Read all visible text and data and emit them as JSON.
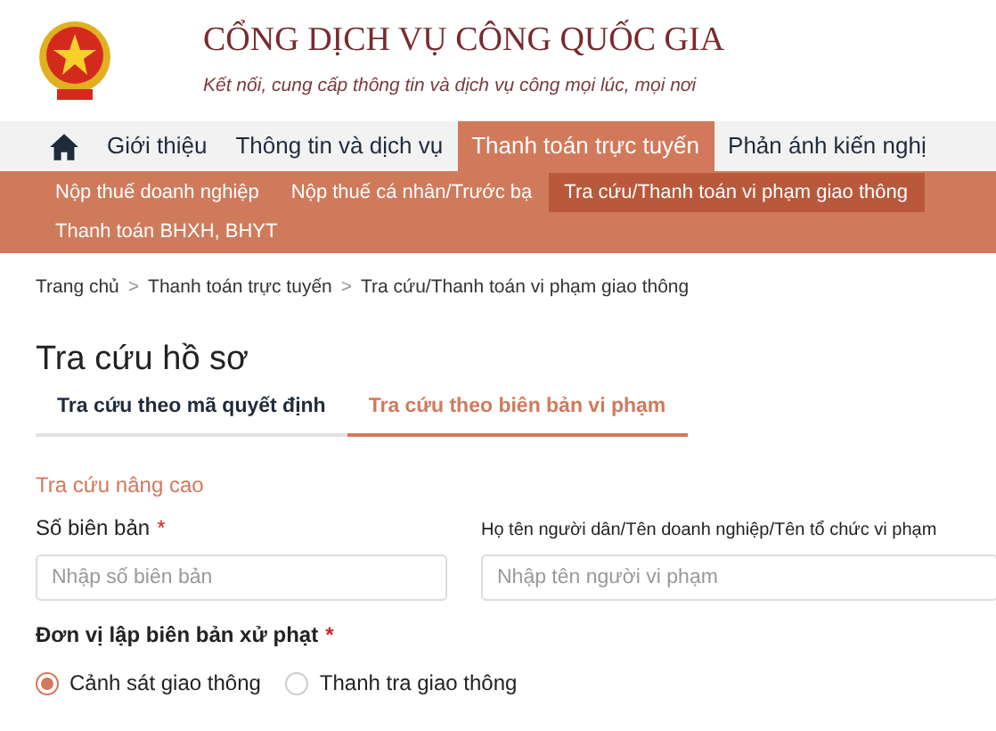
{
  "header": {
    "title": "CỔNG DỊCH VỤ CÔNG QUỐC GIA",
    "tagline": "Kết nối, cung cấp thông tin và dịch vụ công mọi lúc, mọi nơi"
  },
  "nav": {
    "items": [
      {
        "label": "Giới thiệu",
        "selected": false
      },
      {
        "label": "Thông tin và dịch vụ",
        "selected": false
      },
      {
        "label": "Thanh toán trực tuyến",
        "selected": true
      },
      {
        "label": "Phản ánh kiến nghị",
        "selected": false
      }
    ]
  },
  "submenu": {
    "items": [
      {
        "label": "Nộp thuế doanh nghiệp",
        "selected": false
      },
      {
        "label": "Nộp thuế cá nhân/Trước bạ",
        "selected": false
      },
      {
        "label": "Tra cứu/Thanh toán vi phạm giao thông",
        "selected": true
      },
      {
        "label": "Thanh toán BHXH, BHYT",
        "selected": false
      }
    ]
  },
  "breadcrumb": [
    "Trang chủ",
    "Thanh toán trực tuyến",
    "Tra cứu/Thanh toán vi phạm giao thông"
  ],
  "breadcrumb_separator": ">",
  "page_title": "Tra cứu hồ sơ",
  "tabs": [
    {
      "label": "Tra cứu theo mã quyết định",
      "selected": false
    },
    {
      "label": "Tra cứu theo biên bản vi phạm",
      "selected": true
    }
  ],
  "section_title": "Tra cứu nâng cao",
  "fields": [
    {
      "label": "Số biên bản",
      "required_mark": "*",
      "placeholder": "Nhập số biên bản"
    },
    {
      "label": "Họ tên người dân/Tên doanh nghiệp/Tên tổ chức vi phạm",
      "placeholder": "Nhập tên người vi phạm"
    }
  ],
  "radio_group": {
    "label": "Đơn vị lập biên bản xử phạt",
    "required_mark": "*",
    "options": [
      {
        "label": "Cảnh sát giao thông",
        "selected": true
      },
      {
        "label": "Thanh tra giao thông",
        "selected": false
      }
    ]
  }
}
